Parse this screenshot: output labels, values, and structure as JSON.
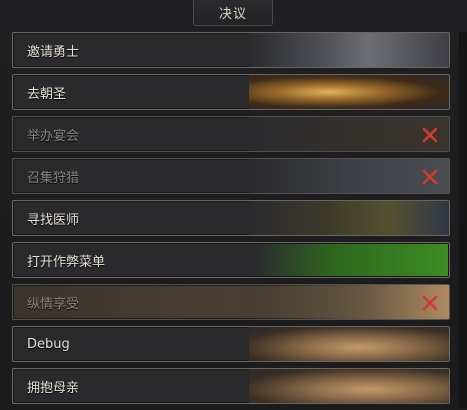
{
  "panel": {
    "title": "决议"
  },
  "decisions": [
    {
      "label": "邀请勇士",
      "available": true
    },
    {
      "label": "去朝圣",
      "available": true
    },
    {
      "label": "举办宴会",
      "available": false,
      "blocked_icon": "close-icon"
    },
    {
      "label": "召集狩猎",
      "available": false,
      "blocked_icon": "close-icon"
    },
    {
      "label": "寻找医师",
      "available": true
    },
    {
      "label": "打开作弊菜单",
      "available": true,
      "highlight_color": "#3c8c23"
    },
    {
      "label": "纵情享受",
      "available": false,
      "blocked_icon": "close-icon"
    },
    {
      "label": "Debug",
      "available": true
    },
    {
      "label": "拥抱母亲",
      "available": true
    }
  ],
  "colors": {
    "border": "#6b6760",
    "text": "#e6e1d4",
    "disabled_text": "#8a8680",
    "blocked_x": "#d23a2e"
  }
}
